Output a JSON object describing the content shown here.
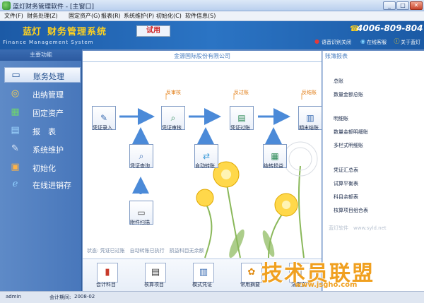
{
  "window": {
    "title": "蓝灯财务管理软件 - [主窗口]",
    "controls": [
      "minimize",
      "maximize",
      "close"
    ]
  },
  "menu": [
    "文件(F)",
    "财务处理(Z)",
    "固定资产(G)",
    "报表(R)",
    "系统维护(P)",
    "初始化(C)",
    "软件信息(S)"
  ],
  "banner": {
    "brand_a": "蓝灯",
    "brand_b": "财务管理系统",
    "subtitle": "Finance Management System",
    "trial": "试用",
    "phone": "4006-809-804",
    "buttons": [
      "语音识别关闭",
      "在线客服",
      "关于蓝灯"
    ]
  },
  "sidebar": {
    "header": "主要功能",
    "items": [
      {
        "label": "账务处理",
        "icon": "monitor-icon",
        "active": true
      },
      {
        "label": "出纳管理",
        "icon": "coins-icon",
        "active": false
      },
      {
        "label": "固定资产",
        "icon": "assets-icon",
        "active": false
      },
      {
        "label": "报　表",
        "icon": "report-icon",
        "active": false
      },
      {
        "label": "系统维护",
        "icon": "tools-icon",
        "active": false
      },
      {
        "label": "初始化",
        "icon": "box-icon",
        "active": false
      },
      {
        "label": "在线进销存",
        "icon": "ie-icon",
        "active": false
      }
    ]
  },
  "main": {
    "title": "金源国际股份有限公司",
    "annotations": [
      "反审核",
      "反过账",
      "反结账"
    ],
    "nodes": {
      "voucher_entry": "凭证录入",
      "voucher_review": "凭证审核",
      "voucher_post": "凭证过账",
      "period_close": "期末结账",
      "voucher_query": "凭证查询",
      "auto_transfer": "自动转账",
      "carry_profit": "结转损益",
      "attach_scan": "附件扫描"
    },
    "status": "状态: 凭证已过账　自动转账已执行　损益科目无余额",
    "toolbar": [
      "会计科目",
      "核算项目",
      "模式凭证",
      "常用摘要",
      "法定文"
    ]
  },
  "right_panel": {
    "header": "账簿报表",
    "groups": [
      [
        "总账",
        "数量金额总账"
      ],
      [
        "明细账",
        "数量金额明细账",
        "多栏式明细账"
      ],
      [
        "凭证汇总表",
        "试算平衡表",
        "科目余额表",
        "核算项目组合表"
      ]
    ],
    "soft_mark": "蓝灯软件　www.syld.net"
  },
  "watermark": {
    "main": "技术员联盟",
    "url": "www.jsgho.com"
  },
  "statusbar": {
    "user": "admin",
    "period_label": "会计期间:",
    "period_value": "2008-02"
  },
  "colors": {
    "brand_yellow": "#ffd21f",
    "banner_blue": "#2b74c4",
    "sidebar_blue": "#4877bb",
    "flow_arrow": "#4b8ad8",
    "annotation_orange": "#e07a10",
    "trial_red": "#d02020"
  }
}
